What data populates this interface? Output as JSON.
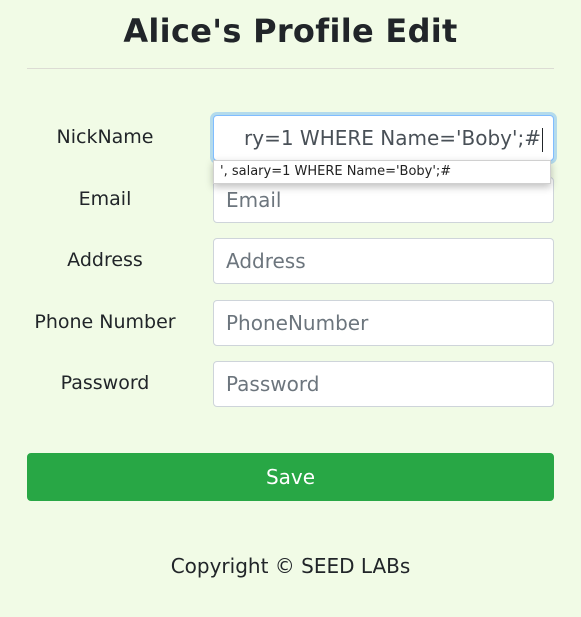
{
  "header": {
    "title": "Alice's Profile Edit"
  },
  "form": {
    "nickname": {
      "label": "NickName",
      "value": "ry=1 WHERE Name='Boby';#",
      "autocomplete_suggestion": "', salary=1 WHERE Name='Boby';#"
    },
    "email": {
      "label": "Email",
      "placeholder": "Email"
    },
    "address": {
      "label": "Address",
      "placeholder": "Address"
    },
    "phone": {
      "label": "Phone Number",
      "placeholder": "PhoneNumber"
    },
    "password": {
      "label": "Password",
      "placeholder": "Password"
    },
    "save_label": "Save"
  },
  "footer": {
    "copyright": "Copyright © SEED LABs"
  },
  "colors": {
    "background": "#f1fbe6",
    "save_button": "#28a745",
    "focus_ring": "#80bdff"
  }
}
